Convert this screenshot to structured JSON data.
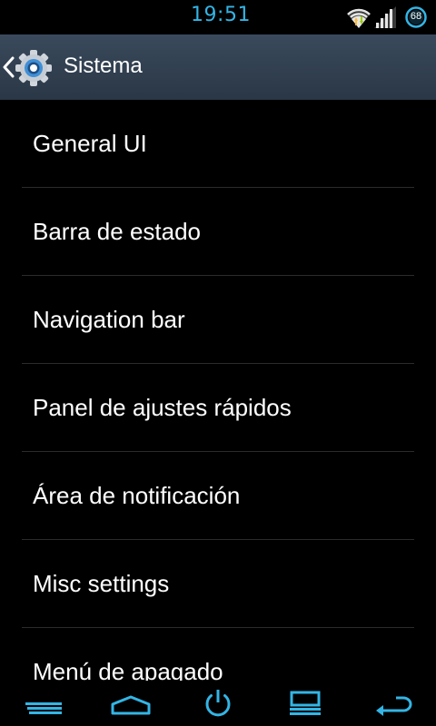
{
  "status_bar": {
    "time": "19:51",
    "battery_level": "68",
    "icons": [
      "wifi-icon",
      "signal-icon",
      "battery-icon"
    ],
    "accent_color": "#33b5e5"
  },
  "action_bar": {
    "title": "Sistema",
    "icons": [
      "back-chevron-icon",
      "gear-icon"
    ]
  },
  "list": {
    "items": [
      {
        "label": "General UI"
      },
      {
        "label": "Barra de estado"
      },
      {
        "label": "Navigation bar"
      },
      {
        "label": "Panel de ajustes rápidos"
      },
      {
        "label": "Área de notificación"
      },
      {
        "label": "Misc settings"
      },
      {
        "label": "Menú de apagado"
      }
    ]
  },
  "nav_bar": {
    "buttons": [
      "menu-icon",
      "home-icon",
      "power-icon",
      "recent-apps-icon",
      "back-icon"
    ]
  }
}
